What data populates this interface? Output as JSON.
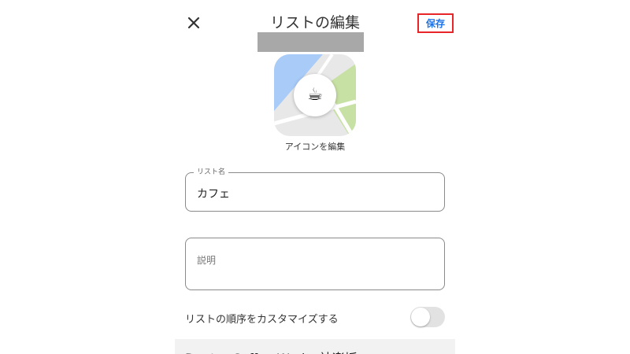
{
  "header": {
    "title": "リストの編集",
    "save_label": "保存",
    "close_glyph": "×"
  },
  "list_icon": {
    "emoji": "☕",
    "edit_label": "アイコンを編集",
    "colors": {
      "map_base": "#e8e8e8",
      "water": "#a8cbf7",
      "park": "#c7e0a3",
      "road": "#ffffff"
    }
  },
  "form": {
    "name_field": {
      "label": "リスト名",
      "value": "カフェ"
    },
    "description_field": {
      "placeholder": "説明",
      "value": ""
    },
    "customize_order": {
      "label": "リストの順序をカスタマイズする",
      "enabled": false
    }
  },
  "bottom_item": {
    "text": "Doutor Coffee Works 神楽坂"
  },
  "colors": {
    "accent": "#1a73e8",
    "highlight_box": "#e8262a",
    "redaction": "#a8a8a8"
  }
}
